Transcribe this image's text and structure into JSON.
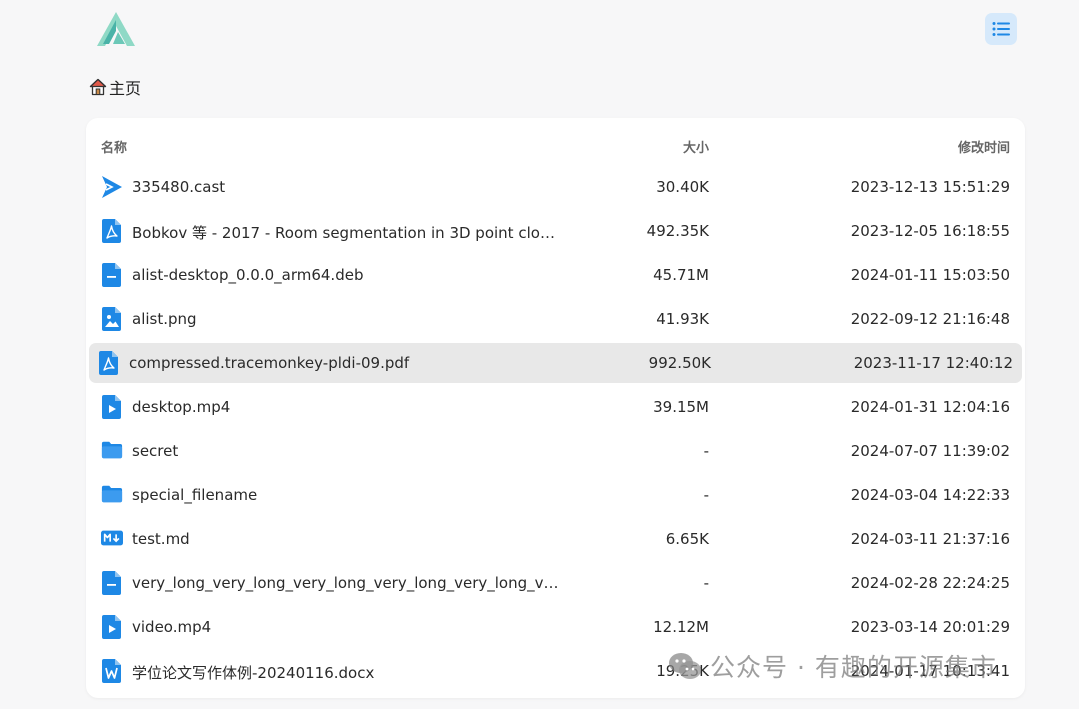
{
  "header": {
    "logo_icon": "alist-logo-icon",
    "layout_toggle_icon": "list-view-icon"
  },
  "breadcrumb": {
    "home_icon": "home-icon",
    "label": "主页"
  },
  "table": {
    "columns": {
      "name": "名称",
      "size": "大小",
      "modified": "修改时间"
    },
    "rows": [
      {
        "icon": "video-cast-icon",
        "name": "335480.cast",
        "size": "30.40K",
        "modified": "2023-12-13 15:51:29"
      },
      {
        "icon": "pdf-file-icon",
        "name": "Bobkov 等 - 2017 - Room segmentation in 3D point cloud...",
        "size": "492.35K",
        "modified": "2023-12-05 16:18:55"
      },
      {
        "icon": "text-file-icon",
        "name": "alist-desktop_0.0.0_arm64.deb",
        "size": "45.71M",
        "modified": "2024-01-11 15:03:50"
      },
      {
        "icon": "image-file-icon",
        "name": "alist.png",
        "size": "41.93K",
        "modified": "2022-09-12 21:16:48"
      },
      {
        "icon": "pdf-file-icon",
        "name": "compressed.tracemonkey-pldi-09.pdf",
        "size": "992.50K",
        "modified": "2023-11-17 12:40:12",
        "selected": true
      },
      {
        "icon": "video-file-icon",
        "name": "desktop.mp4",
        "size": "39.15M",
        "modified": "2024-01-31 12:04:16"
      },
      {
        "icon": "folder-icon",
        "name": "secret",
        "size": "-",
        "modified": "2024-07-07 11:39:02"
      },
      {
        "icon": "folder-icon",
        "name": "special_filename",
        "size": "-",
        "modified": "2024-03-04 14:22:33"
      },
      {
        "icon": "markdown-file-icon",
        "name": "test.md",
        "size": "6.65K",
        "modified": "2024-03-11 21:37:16"
      },
      {
        "icon": "text-file-icon",
        "name": "very_long_very_long_very_long_very_long_very_long_very_...",
        "size": "-",
        "modified": "2024-02-28 22:24:25"
      },
      {
        "icon": "video-file-icon",
        "name": "video.mp4",
        "size": "12.12M",
        "modified": "2023-03-14 20:01:29"
      },
      {
        "icon": "word-file-icon",
        "name": "学位论文写作体例-20240116.docx",
        "size": "19.25K",
        "modified": "2024-01-17 10:13:41"
      }
    ]
  },
  "watermark": {
    "icon": "wechat-icon",
    "text": "公众号 · 有趣的开源集市"
  },
  "colors": {
    "accent": "#1e88e5",
    "logo_light": "#7fd6c2",
    "logo_dark": "#3aa6a0",
    "selected_row": "#e8e8e8",
    "toggle_bg": "#d6e9fb"
  }
}
